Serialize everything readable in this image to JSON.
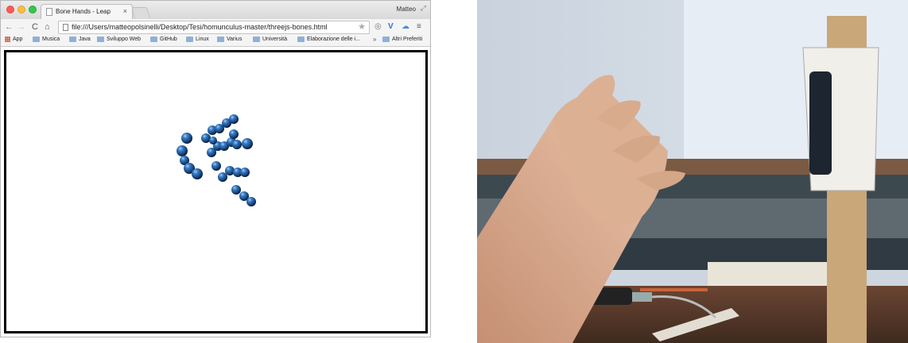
{
  "browser": {
    "tab": {
      "title": "Bone Hands - Leap",
      "close_glyph": "×"
    },
    "profile_name": "Matteo",
    "toolbar": {
      "back_glyph": "←",
      "forward_glyph": "→",
      "reload_glyph": "C",
      "home_glyph": "⌂",
      "url": "file:///Users/matteopolsinelli/Desktop/Tesi/homunculus-master/threejs-bones.html",
      "star_glyph": "★",
      "ext1_glyph": "◎",
      "ext2_glyph": "V",
      "ext3_glyph": "☁",
      "menu_glyph": "≡"
    },
    "bookmarks": {
      "apps_label": "App",
      "items": [
        "Musica",
        "Java",
        "Sviluppo Web",
        "GitHub",
        "Linux",
        "Varius",
        "Università",
        "Elaborazione delle i..."
      ],
      "chevron": "»",
      "other_label": "Altri Preferiti"
    },
    "canvas": {
      "joint_color": "#1e5a99",
      "joint_count": 30
    }
  },
  "photo": {
    "subject": "hand raised above Leap Motion controller",
    "colors": {
      "wall": "#cfd7e1",
      "desk": "#5a3d2c",
      "skin": "#d8a98c"
    }
  }
}
